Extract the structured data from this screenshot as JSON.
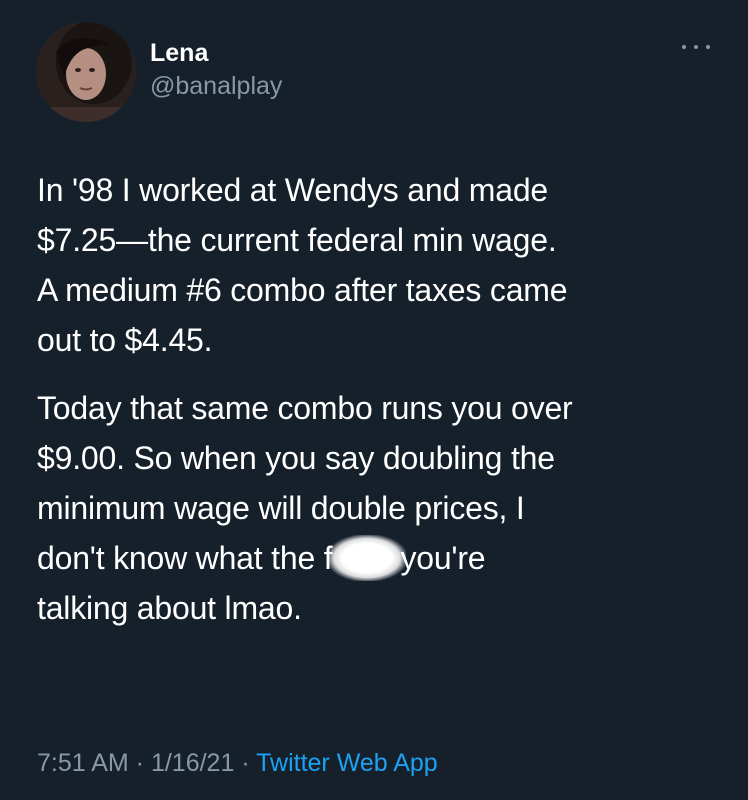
{
  "author": {
    "display_name": "Lena",
    "handle": "@banalplay"
  },
  "menu": {
    "icon": "more-horizontal-icon"
  },
  "tweet": {
    "paragraph1": [
      "In '98 I worked at Wendys and made",
      "$7.25—the current federal min wage.",
      "A medium #6 combo after taxes came",
      "out to $4.45."
    ],
    "paragraph2": [
      "Today that same combo runs you over",
      "$9.00. So when you say doubling the",
      "minimum wage will double prices, I"
    ],
    "censored_line_start": "don't know what the f",
    "censored_line_end": "you're",
    "last_line": "talking about lmao."
  },
  "meta": {
    "time": "7:51 AM",
    "separator": " · ",
    "date": "1/16/21",
    "source": "Twitter Web App"
  },
  "colors": {
    "background": "#15202b",
    "text": "#ffffff",
    "secondary": "#8899a6",
    "link": "#1da1f2"
  }
}
